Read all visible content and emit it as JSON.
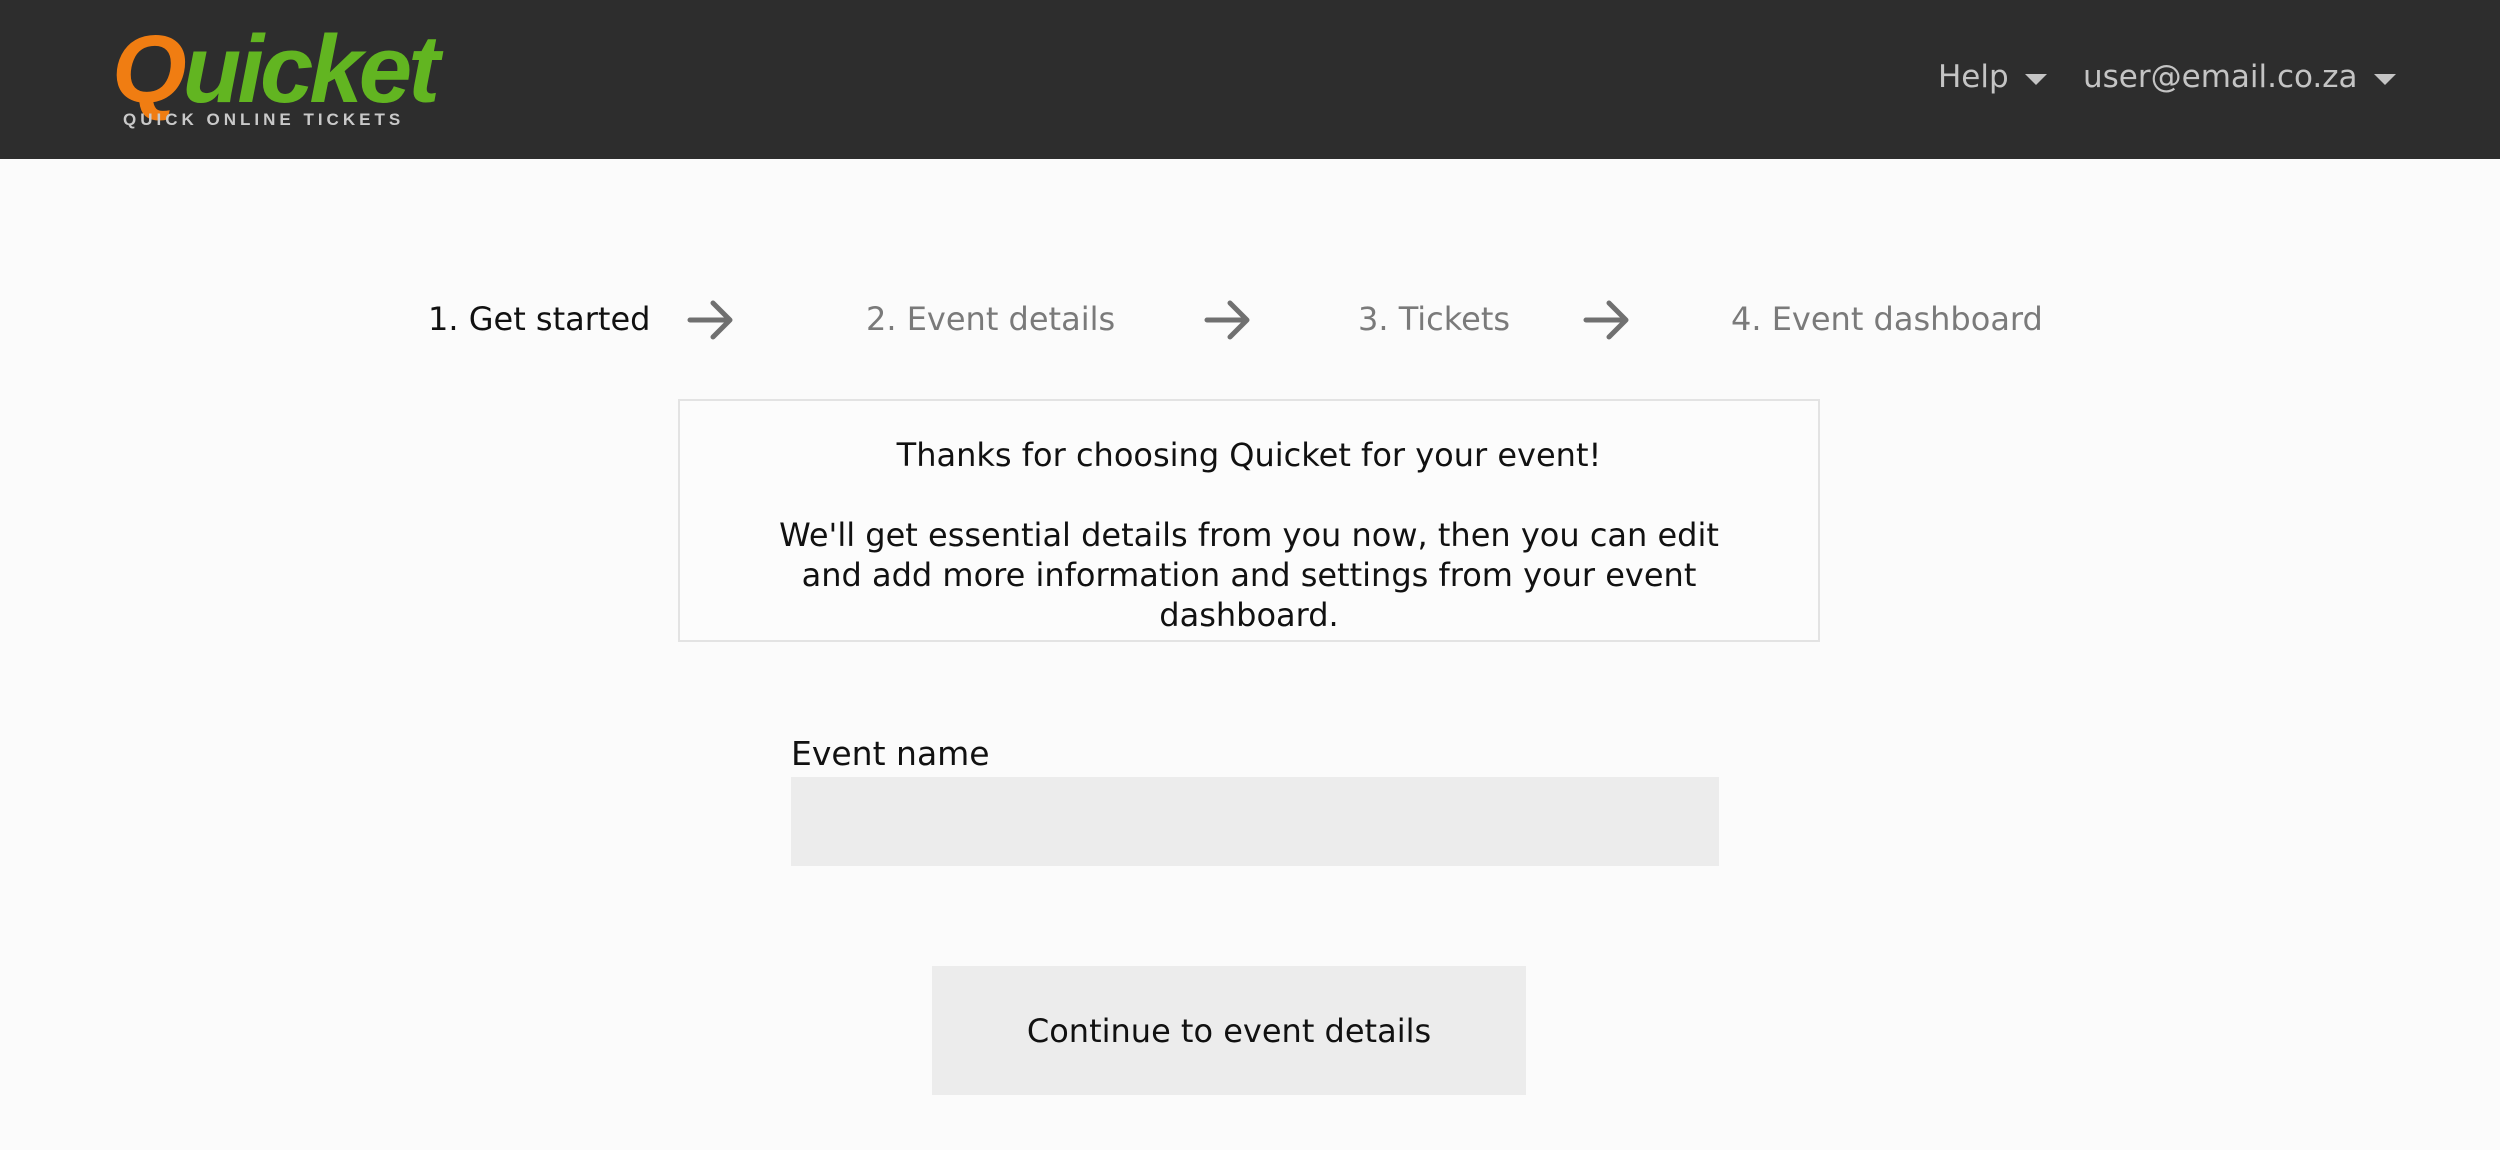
{
  "header": {
    "logo": {
      "word_first": "Q",
      "word_rest": "uicket",
      "tagline": "QUICK ONLINE TICKETS"
    },
    "help_menu": {
      "label": "Help",
      "icon": "chevron-down-icon"
    },
    "user_menu": {
      "label": "user@email.co.za",
      "icon": "chevron-down-icon"
    }
  },
  "steps": [
    {
      "label": "1. Get started",
      "active": true
    },
    {
      "label": "2. Event details",
      "active": false
    },
    {
      "label": "3. Tickets",
      "active": false
    },
    {
      "label": "4. Event dashboard",
      "active": false
    }
  ],
  "step_separator_icon": "arrow-right-icon",
  "intro": {
    "heading": "Thanks for choosing Quicket for your event!",
    "body": "We'll get essential details from you now, then you can edit and add more information and settings from your event dashboard."
  },
  "form": {
    "event_name_label": "Event name",
    "event_name_value": "",
    "event_name_placeholder": ""
  },
  "continue_button": {
    "label": "Continue to event details"
  },
  "colors": {
    "header_bg": "#2d2d2d",
    "logo_orange": "#f07d12",
    "logo_green": "#62b521",
    "page_bg": "#fbfbfb",
    "input_bg": "#ececec",
    "active_step": "#111111",
    "inactive_step": "#7a7a7a"
  }
}
